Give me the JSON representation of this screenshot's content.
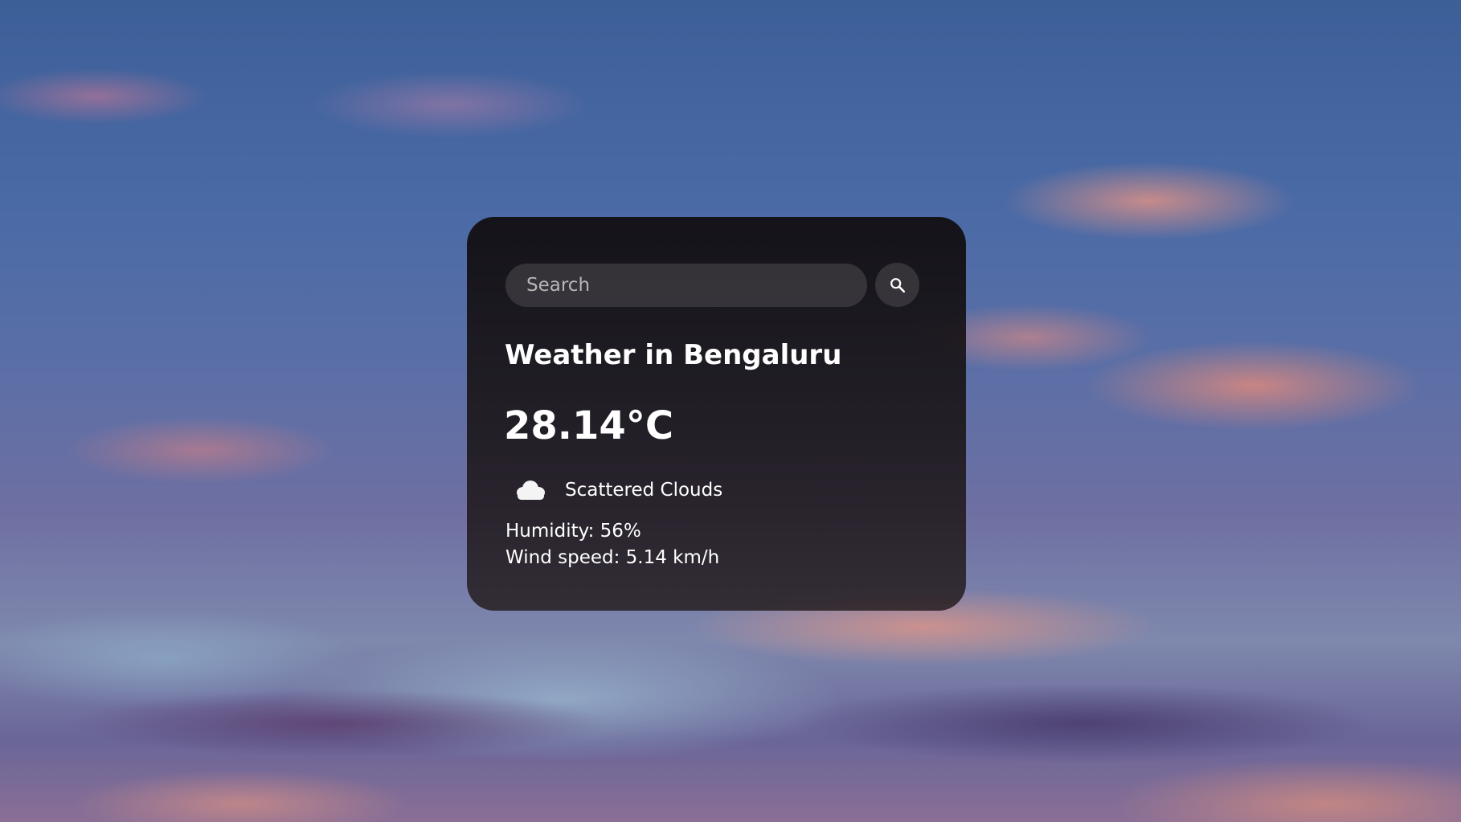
{
  "search": {
    "placeholder": "Search",
    "value": ""
  },
  "weather": {
    "title": "Weather in Bengaluru",
    "temperature": "28.14°C",
    "condition": "Scattered Clouds",
    "condition_icon": "cloud-icon",
    "humidity": "Humidity: 56%",
    "wind": "Wind speed: 5.14 km/h"
  },
  "icons": {
    "search": "search-icon"
  },
  "colors": {
    "card_background": "#1a1416",
    "text": "#ffffff",
    "input_background": "#4a4548"
  }
}
